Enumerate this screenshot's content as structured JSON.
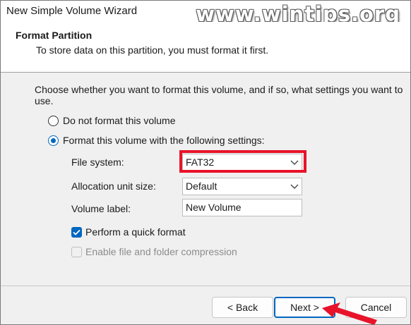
{
  "window": {
    "title": "New Simple Volume Wizard",
    "watermark": "www.wintips.org"
  },
  "header": {
    "title": "Format Partition",
    "subtitle": "To store data on this partition, you must format it first."
  },
  "content": {
    "intro": "Choose whether you want to format this volume, and if so, what settings you want to use.",
    "radio_no_format": "Do not format this volume",
    "radio_format": "Format this volume with the following settings:",
    "file_system_label": "File system:",
    "file_system_value": "FAT32",
    "allocation_label": "Allocation unit size:",
    "allocation_value": "Default",
    "volume_label_label": "Volume label:",
    "volume_label_value": "New Volume",
    "quick_format_label": "Perform a quick format",
    "compression_label": "Enable file and folder compression"
  },
  "buttons": {
    "back": "< Back",
    "next": "Next >",
    "cancel": "Cancel"
  },
  "state": {
    "selected_radio": "format",
    "quick_format_checked": true,
    "compression_enabled": false
  },
  "colors": {
    "accent": "#0067c0",
    "highlight": "#e8132a"
  },
  "icons": {
    "dropdown": "chevron-down-icon",
    "checkbox_check": "checkmark-icon",
    "annotation": "red-arrow-icon"
  }
}
